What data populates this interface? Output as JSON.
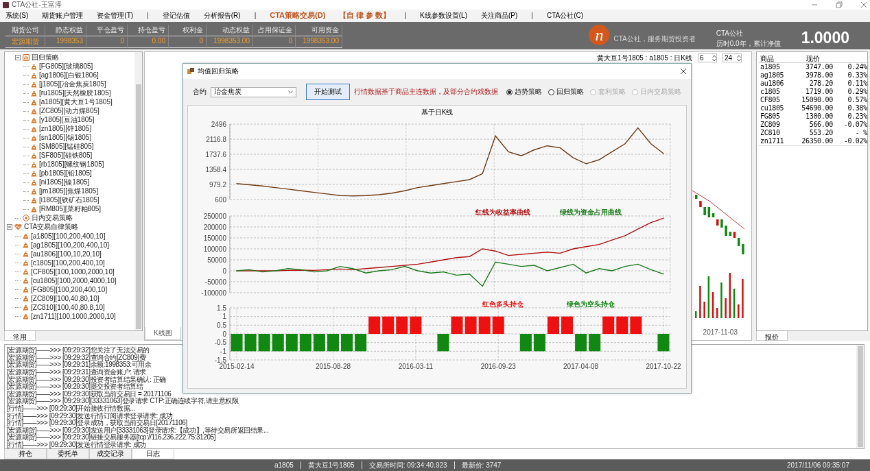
{
  "window": {
    "title": "CTA公社-王富泽"
  },
  "menu": [
    {
      "label": "系统(S)",
      "kind": "item"
    },
    {
      "label": "期货账户管理",
      "kind": "item"
    },
    {
      "label": "资金管理(T)",
      "kind": "item"
    },
    {
      "label": "|",
      "kind": "separator"
    },
    {
      "label": "登记估值",
      "kind": "item"
    },
    {
      "label": "分析报告(R)",
      "kind": "item"
    },
    {
      "label": "|",
      "kind": "separator"
    },
    {
      "label": "CTA策略交易(D)",
      "kind": "highlight"
    },
    {
      "label": "【自 律 参 数】",
      "kind": "highlight"
    },
    {
      "label": "|",
      "kind": "separator"
    },
    {
      "label": "K线参数设置(L)",
      "kind": "item"
    },
    {
      "label": "关注商品(P)",
      "kind": "item"
    },
    {
      "label": "|",
      "kind": "separator"
    },
    {
      "label": "CTA公社(C)",
      "kind": "item"
    }
  ],
  "account": {
    "columns": [
      "期货公司",
      "静态权益",
      "平仓盈亏",
      "持仓盈亏",
      "权利金",
      "动态权益",
      "占用保证金",
      "可用资金"
    ],
    "rows": [
      [
        "宏源期货",
        "1998353",
        "0",
        "0.00",
        "0",
        "1998353.00",
        "0",
        "1998353.00"
      ]
    ]
  },
  "brand": {
    "mark": "n",
    "tagline": "CTA公社，服务期货投资者"
  },
  "net_value": {
    "title": "CTA公社",
    "caption": "历时0.0年，累计净值",
    "value": "1.0000"
  },
  "tree": {
    "items": [
      {
        "kind": "continued",
        "children": [
          {
            "label": "回归策略",
            "kind": "folder",
            "expanded": true,
            "children": [
              {
                "label": "[FG805][玻璃805]",
                "kind": "contract"
              },
              {
                "label": "[ag1806][白银1806]",
                "kind": "contract"
              },
              {
                "label": "[j1805][冶金焦炭1805]",
                "kind": "contract"
              },
              {
                "label": "[ru1805][天然橡胶1805]",
                "kind": "contract"
              },
              {
                "label": "[a1805][黄大豆1号1805]",
                "kind": "contract"
              },
              {
                "label": "[ZC805][动力煤805]",
                "kind": "contract"
              },
              {
                "label": "[y1805][豆油1805]",
                "kind": "contract"
              },
              {
                "label": "[zn1805][锌1805]",
                "kind": "contract"
              },
              {
                "label": "[sn1805][锡1805]",
                "kind": "contract"
              },
              {
                "label": "[SM805][锰硅805]",
                "kind": "contract"
              },
              {
                "label": "[SF805][硅铁805]",
                "kind": "contract"
              },
              {
                "label": "[rb1805][螺纹钢1805]",
                "kind": "contract"
              },
              {
                "label": "[pb1805][铅1805]",
                "kind": "contract"
              },
              {
                "label": "[ni1805][镍1805]",
                "kind": "contract"
              },
              {
                "label": "[jm1805][焦煤1805]",
                "kind": "contract"
              },
              {
                "label": "[i1805][铁矿石1805]",
                "kind": "contract"
              },
              {
                "label": "[RM805][菜籽粕805]",
                "kind": "contract"
              }
            ]
          },
          {
            "label": "日内交易策略",
            "kind": "target"
          }
        ]
      },
      {
        "label": "CTA交易自律策略",
        "kind": "heart",
        "expanded": true,
        "children": [
          {
            "label": "[a1805][100,200,400,10]",
            "kind": "contract"
          },
          {
            "label": "[ag1805][100,200,400,10]",
            "kind": "contract"
          },
          {
            "label": "[au1806][100,10,20,10]",
            "kind": "contract"
          },
          {
            "label": "[c1805][100,200,400,10]",
            "kind": "contract"
          },
          {
            "label": "[CF805][100,1000,2000,10]",
            "kind": "contract"
          },
          {
            "label": "[cu1805][100,2000,4000,10]",
            "kind": "contract"
          },
          {
            "label": "[FG805][100,200,400,10]",
            "kind": "contract"
          },
          {
            "label": "[ZC809][100,40,80,10]",
            "kind": "contract"
          },
          {
            "label": "[ZC810][100,40,80.8,10]",
            "kind": "contract"
          },
          {
            "label": "[zn1711][100,1000,2000,10]",
            "kind": "contract"
          }
        ]
      }
    ]
  },
  "left_tab": "常用",
  "kline": {
    "title": "黄大豆1号1805 : a1805 : 日K线",
    "spin_1": "6",
    "spin_2": "24",
    "date_label": "2017-11-03",
    "tab": "K线图"
  },
  "quotes": {
    "columns": [
      "商品",
      "现价"
    ],
    "tab": "报价",
    "rows": [
      [
        "a1805",
        "3747.00",
        "0.24%"
      ],
      [
        "ag1805",
        "3978.00",
        "0.33%"
      ],
      [
        "au1806",
        "278.20",
        "0.11%"
      ],
      [
        "c1805",
        "1719.00",
        "0.29%"
      ],
      [
        "CF805",
        "15090.00",
        "0.57%"
      ],
      [
        "cu1805",
        "54690.00",
        "0.38%"
      ],
      [
        "FG805",
        "1300.00",
        "0.23%"
      ],
      [
        "ZC809",
        "566.00",
        "-0.07%"
      ],
      [
        "ZC810",
        "553.20",
        "- %"
      ],
      [
        "zn1711",
        "26350.00",
        "-0.02%"
      ]
    ]
  },
  "dialog": {
    "title": "均值回归策略",
    "contract_label": "合约",
    "contract_value": "冶金焦炭",
    "run_button": "开始测试",
    "note": "行情数据基于商品主连数据，及部分合约戏数据",
    "strategies": [
      {
        "label": "趋势策略",
        "selected": true,
        "disabled": false
      },
      {
        "label": "回归策略",
        "selected": false,
        "disabled": false
      },
      {
        "label": "套利策略",
        "selected": false,
        "disabled": true
      },
      {
        "label": "日内交易策略",
        "selected": false,
        "disabled": true
      }
    ],
    "chart_title": "基于日K线",
    "charts": [
      {
        "chart_data": {
          "type": "line",
          "grid": true,
          "categories": [
            null,
            null,
            null,
            null,
            null,
            null,
            null,
            null,
            null,
            null,
            null,
            null,
            null,
            null,
            null,
            null,
            null,
            null,
            null,
            null,
            null,
            null,
            null,
            null,
            null,
            null,
            null,
            null,
            null,
            null,
            null,
            null,
            null,
            null
          ],
          "ylim": [
            600,
            2496
          ],
          "yticks": [
            {
              "value": 600,
              "label": "600"
            },
            {
              "value": 979.2,
              "label": "979.2"
            },
            {
              "value": 1358.4,
              "label": "1358.4"
            },
            {
              "value": 1737.6,
              "label": "1737.6"
            },
            {
              "value": 2116.8,
              "label": "2116.8"
            },
            {
              "value": 2496,
              "label": "2496"
            }
          ],
          "series": [
            {
              "color": "#6e3a12",
              "values": [
                1000,
                970,
                940,
                900,
                860,
                820,
                780,
                740,
                700,
                690,
                700,
                720,
                760,
                820,
                900,
                950,
                1000,
                1050,
                1100,
                1250,
                2200,
                1800,
                1700,
                1850,
                1950,
                1900,
                1650,
                1500,
                1600,
                1800,
                2000,
                2400,
                2000,
                1750
              ]
            }
          ]
        }
      },
      {
        "chart_data": {
          "type": "line",
          "grid": true,
          "categories": [
            null,
            null,
            null,
            null,
            null,
            null,
            null,
            null,
            null,
            null,
            null,
            null,
            null,
            null,
            null,
            null,
            null,
            null,
            null,
            null,
            null,
            null,
            null,
            null,
            null,
            null,
            null,
            null,
            null,
            null,
            null,
            null,
            null,
            null
          ],
          "ylim": [
            -100000,
            250000
          ],
          "yticks": [
            {
              "value": -100000,
              "label": "-100000"
            },
            {
              "value": -50000,
              "label": "-50000"
            },
            {
              "value": 0,
              "label": "0"
            },
            {
              "value": 50000,
              "label": "50000"
            },
            {
              "value": 100000,
              "label": "100000"
            },
            {
              "value": 150000,
              "label": "150000"
            },
            {
              "value": 200000,
              "label": "200000"
            },
            {
              "value": 250000,
              "label": "250000"
            }
          ],
          "annotations": [
            {
              "text": "红线为收益率曲线"
            },
            {
              "text": "绿线为资金占用曲线"
            }
          ],
          "series": [
            {
              "color": "#b01010",
              "values": [
                0,
                0,
                0,
                0,
                2000,
                3000,
                2000,
                5000,
                8000,
                5000,
                10000,
                15000,
                20000,
                25000,
                30000,
                40000,
                50000,
                60000,
                65000,
                100000,
                90000,
                70000,
                75000,
                80000,
                85000,
                80000,
                100000,
                110000,
                120000,
                140000,
                160000,
                190000,
                220000,
                240000
              ]
            },
            {
              "color": "#1a7a1a",
              "values": [
                0,
                5000,
                -5000,
                0,
                10000,
                5000,
                -5000,
                0,
                20000,
                10000,
                -10000,
                0,
                5000,
                20000,
                0,
                -10000,
                -5000,
                -20000,
                -15000,
                -70000,
                40000,
                30000,
                20000,
                25000,
                0,
                15000,
                30000,
                -10000,
                10000,
                0,
                20000,
                30000,
                5000,
                -15000
              ]
            }
          ]
        }
      },
      {
        "chart_data": {
          "type": "bar",
          "grid": true,
          "categories": [
            "2015-02-14",
            null,
            null,
            null,
            null,
            null,
            null,
            "2015-08-28",
            null,
            null,
            null,
            null,
            null,
            "2016-03-11",
            null,
            null,
            null,
            null,
            null,
            "2016-09-23",
            null,
            null,
            null,
            null,
            null,
            "2017-04-08",
            null,
            null,
            null,
            null,
            null,
            "2017-10-22"
          ],
          "ylim": [
            -1.5,
            1.5
          ],
          "yticks": [
            {
              "value": -1.5,
              "label": "-1.5"
            },
            {
              "value": -1,
              "label": "-1"
            },
            {
              "value": -0.5,
              "label": "-0.5"
            },
            {
              "value": 0,
              "label": "0"
            },
            {
              "value": 0.5,
              "label": "0.5"
            },
            {
              "value": 1,
              "label": "1"
            },
            {
              "value": 1.5,
              "label": "1.5"
            }
          ],
          "annotations": [
            {
              "text": "红色多头持仓"
            },
            {
              "text": "绿色为空头持仓"
            }
          ],
          "values": [
            -1,
            -1,
            -1,
            -1,
            -1,
            -1,
            -1,
            -1,
            -1,
            -1,
            1,
            1,
            1,
            1,
            0,
            -1,
            1,
            1,
            1,
            1,
            0,
            -1,
            -1,
            1,
            1,
            -1,
            -1,
            1,
            1,
            1,
            0,
            -1
          ]
        }
      }
    ]
  },
  "log": [
    "[宏源期货]——>>> [09:29:32]您关注了无法交易的",
    "[宏源期货]——>>> [09:29:32]查询合约[ZC809]费",
    "[宏源期货]——>>> [09:29:31]余额:1998353:可用余",
    "[宏源期货]——>>> [09:29:31]查询资金账户: 请求",
    "[宏源期货]——>>> [09:29:30]投资者结算结果确认: 正确",
    "[宏源期货]——>>> [09:29:30]提交投资者结算结",
    "[宏源期货]——>>> [09:29:30]获取当前交易日 = 20171106",
    "[宏源期货]——>>> [09:29:30][33331063]登录请求 CTP:正确连续字符,请主意权限",
    "[行情]——>>> [09:29:30]开始接收行情数据...",
    "[行情]——>>> [09:29:30]发送行情订阅请求登录请求: 成功",
    "[行情]——>>> [09:29:30]登录成功，获取当前交易日[20171106]",
    "[宏源期货]——>>> [09:29:30]发送用户[33331063]登录请求:【成功】,等待交易所返回结果...",
    "[宏源期货]——>>> [09:29:30]链接交易服务器[tcp://116.236.222.75:31205]",
    "[行情]——>>> [09:29:30]发送行情登录请求: 成功"
  ],
  "bottom_tabs": [
    {
      "label": "持仓",
      "selected": false
    },
    {
      "label": "委托单",
      "selected": false
    },
    {
      "label": "成交记录",
      "selected": false
    },
    {
      "label": "日志",
      "selected": true
    }
  ],
  "status_bar": {
    "fields": [
      "a1805",
      "黄大豆1号1805",
      "交易所时间: 09:34:40.923",
      "最新价: 3747"
    ],
    "datetime": "2017/11/06 09:35:07"
  }
}
